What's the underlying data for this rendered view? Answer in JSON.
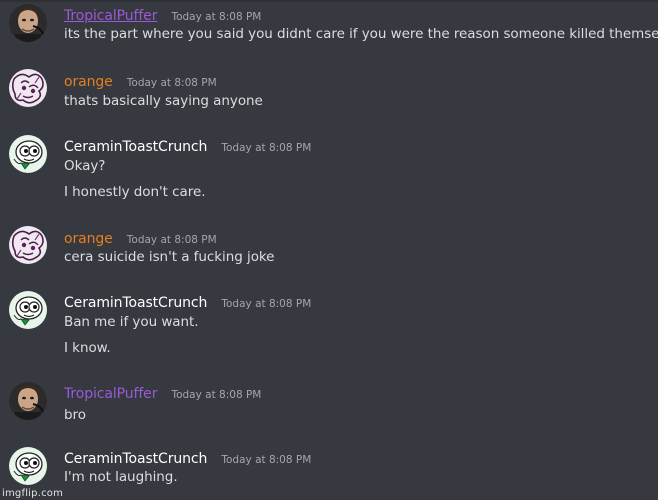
{
  "colors": {
    "background": "#36393f",
    "tropical": "#9b59d6",
    "orange": "#e67e22",
    "ceramin": "#ffffff",
    "message_text": "#dcddde",
    "timestamp": "#a3a6aa"
  },
  "messages": [
    {
      "author": "TropicalPuffer",
      "timestamp": "Today at 8:08 PM",
      "avatar": "photo-avatar",
      "lines": [
        "its the part where you said you didnt care if you were the reason someone killed themself"
      ]
    },
    {
      "author": "orange",
      "timestamp": "Today at 8:08 PM",
      "avatar": "sketch-avatar",
      "lines": [
        "thats basically saying anyone"
      ]
    },
    {
      "author": "CeraminToastCrunch",
      "timestamp": "Today at 8:08 PM",
      "avatar": "cartoon-avatar",
      "lines": [
        "Okay?",
        "I honestly don't care."
      ]
    },
    {
      "author": "orange",
      "timestamp": "Today at 8:08 PM",
      "avatar": "sketch-avatar",
      "lines": [
        "cera suicide isn't a fucking joke"
      ]
    },
    {
      "author": "CeraminToastCrunch",
      "timestamp": "Today at 8:08 PM",
      "avatar": "cartoon-avatar",
      "lines": [
        "Ban me if you want.",
        "I know."
      ]
    },
    {
      "author": "TropicalPuffer",
      "timestamp": "Today at 8:08 PM",
      "avatar": "photo-avatar",
      "lines": [
        "bro"
      ]
    },
    {
      "author": "CeraminToastCrunch",
      "timestamp": "Today at 8:08 PM",
      "avatar": "cartoon-avatar",
      "lines": [
        "I'm not laughing."
      ]
    }
  ],
  "watermark": "imgflip.com"
}
